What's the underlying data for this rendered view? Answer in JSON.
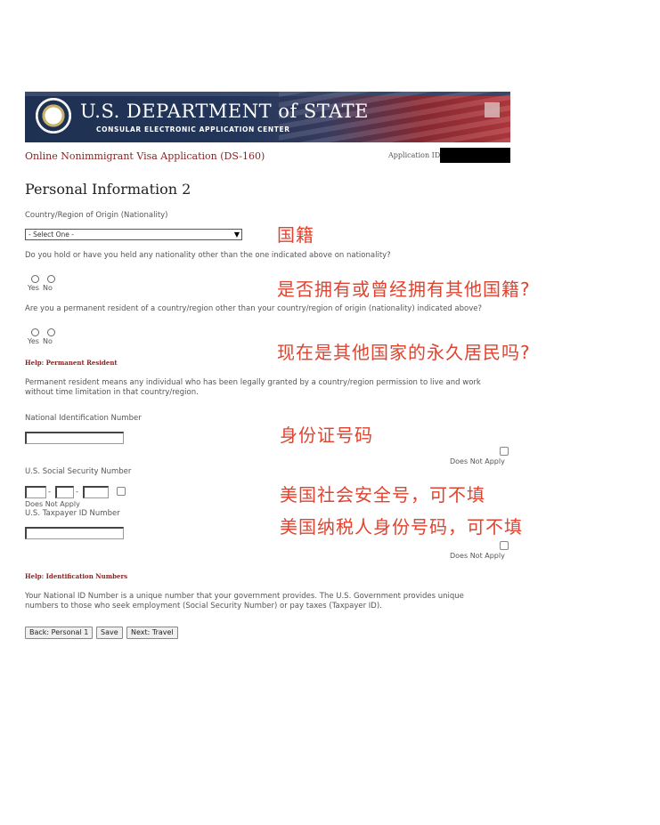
{
  "header": {
    "department": "U.S. DEPARTMENT of STATE",
    "subtitle": "CONSULAR ELECTRONIC APPLICATION CENTER",
    "form_title": "Online Nonimmigrant Visa Application (DS-160)",
    "application_id_label": "Application ID"
  },
  "page": {
    "title": "Personal Information 2"
  },
  "nationality": {
    "label": "Country/Region of Origin (Nationality)",
    "selected": "- Select One -"
  },
  "other_nationality": {
    "question": "Do you hold or have you held any nationality other than the one indicated above on nationality?",
    "yes": "Yes",
    "no": "No"
  },
  "permanent_resident": {
    "question": "Are you a permanent resident of a country/region other than your country/region of origin (nationality) indicated above?",
    "yes": "Yes",
    "no": "No"
  },
  "help_permanent": {
    "prefix": "Help:",
    "title": "Permanent Resident",
    "text": "Permanent resident means any individual who has been legally granted by a country/region permission to live and work without time limitation in that country/region."
  },
  "national_id": {
    "label": "National Identification Number",
    "does_not_apply": "Does Not Apply"
  },
  "ssn": {
    "label": "U.S. Social Security Number",
    "separator": "-",
    "does_not_apply": "Does Not Apply"
  },
  "taxpayer": {
    "label": "U.S. Taxpayer ID Number",
    "does_not_apply": "Does Not Apply"
  },
  "help_id": {
    "prefix": "Help:",
    "title": "Identification Numbers",
    "text": "Your National ID Number is a unique number that your government provides. The U.S. Government provides unique numbers to those who seek employment (Social Security Number) or pay taxes (Taxpayer ID)."
  },
  "buttons": {
    "back": "Back: Personal 1",
    "save": "Save",
    "next": "Next: Travel"
  },
  "annotations": {
    "nationality": "国籍",
    "other_nationality": "是否拥有或曾经拥有其他国籍?",
    "permanent_resident": "现在是其他国家的永久居民吗?",
    "national_id": "身份证号码",
    "ssn": "美国社会安全号，可不填",
    "taxpayer": "美国纳税人身份号码，可不填"
  },
  "colors": {
    "annotation": "#e0432f",
    "form_title": "#8a1f1f",
    "banner_blue": "#1e3152",
    "banner_red": "#b43a3f"
  }
}
